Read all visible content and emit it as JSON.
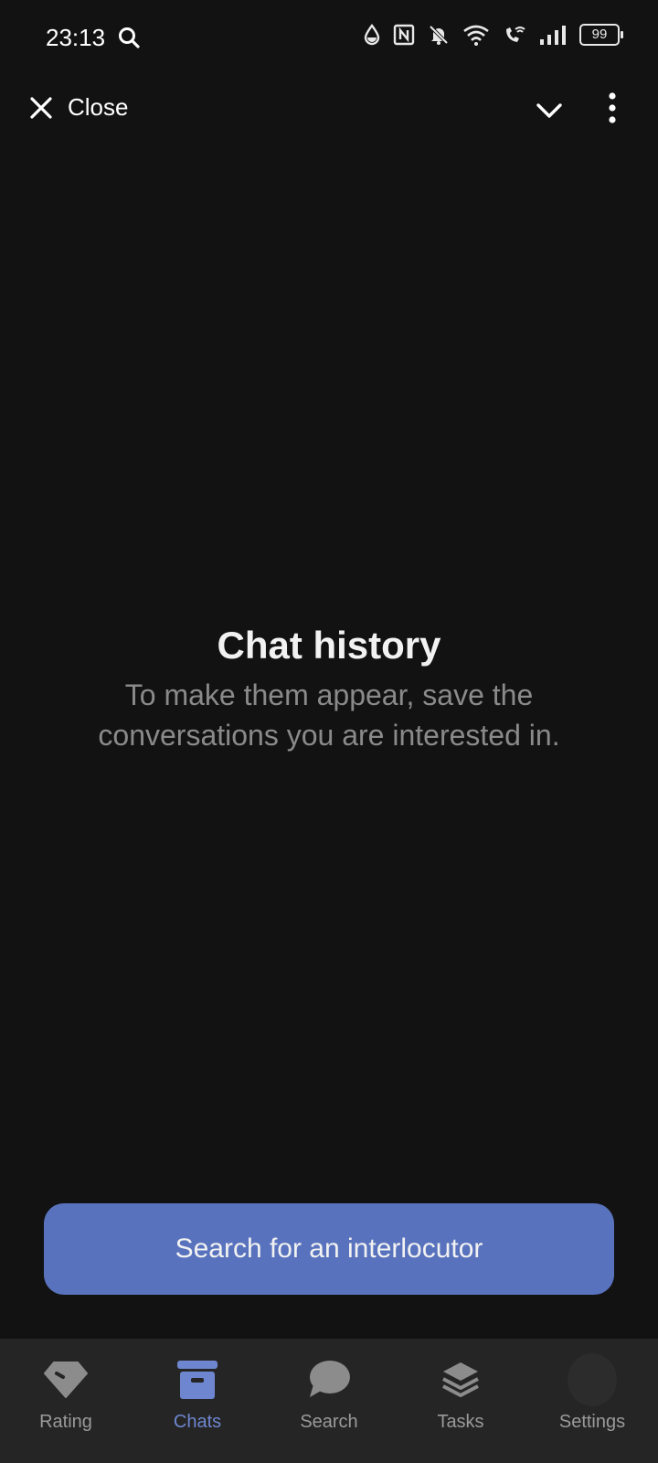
{
  "status_bar": {
    "time": "23:13",
    "battery": "99",
    "icons": [
      "search-icon",
      "water-drop-icon",
      "nfc-icon",
      "bell-off-icon",
      "wifi-icon",
      "wifi-call-icon",
      "signal-icon",
      "battery-icon"
    ]
  },
  "top_bar": {
    "close_label": "Close",
    "icons": [
      "close-icon",
      "chevron-down-icon",
      "more-vertical-icon"
    ]
  },
  "empty_state": {
    "title": "Chat history",
    "subtitle": "To make them appear, save the conversations you are interested in."
  },
  "cta": {
    "label": "Search for an interlocutor"
  },
  "bottom_nav": {
    "items": [
      {
        "label": "Rating",
        "icon": "diamond-tag-icon",
        "active": false
      },
      {
        "label": "Chats",
        "icon": "archive-box-icon",
        "active": true
      },
      {
        "label": "Search",
        "icon": "chat-bubble-icon",
        "active": false
      },
      {
        "label": "Tasks",
        "icon": "layers-icon",
        "active": false
      },
      {
        "label": "Settings",
        "icon": "avatar",
        "active": false
      }
    ]
  },
  "colors": {
    "background": "#121212",
    "accent": "#5872bd",
    "active_nav": "#6e86cf",
    "nav_background": "#252525",
    "muted_text": "#8a8a8a"
  }
}
